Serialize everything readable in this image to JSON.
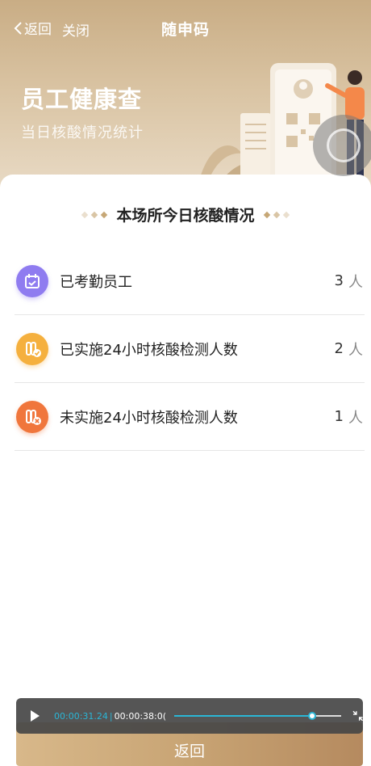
{
  "nav": {
    "back_label": "返回",
    "close_label": "关闭",
    "title": "随申码"
  },
  "hero": {
    "title": "员工健康查",
    "subtitle": "当日核酸情况统计"
  },
  "section": {
    "title": "本场所今日核酸情况"
  },
  "stats": [
    {
      "label": "已考勤员工",
      "value": "3",
      "unit": "人",
      "icon": "calendar-check-icon",
      "color": "#8f7cf0"
    },
    {
      "label": "已实施24小时核酸检测人数",
      "value": "2",
      "unit": "人",
      "icon": "test-tube-check-icon",
      "color": "#f5b03e"
    },
    {
      "label": "未实施24小时核酸检测人数",
      "value": "1",
      "unit": "人",
      "icon": "test-tube-cross-icon",
      "color": "#f0763c"
    }
  ],
  "player": {
    "current_time": "00:00:31.24",
    "total_time": "00:00:38:0(",
    "progress": 0.83
  },
  "bottom": {
    "return_label": "返回"
  },
  "colors": {
    "accent": "#c9ad85",
    "player_accent": "#2ab6d6"
  }
}
